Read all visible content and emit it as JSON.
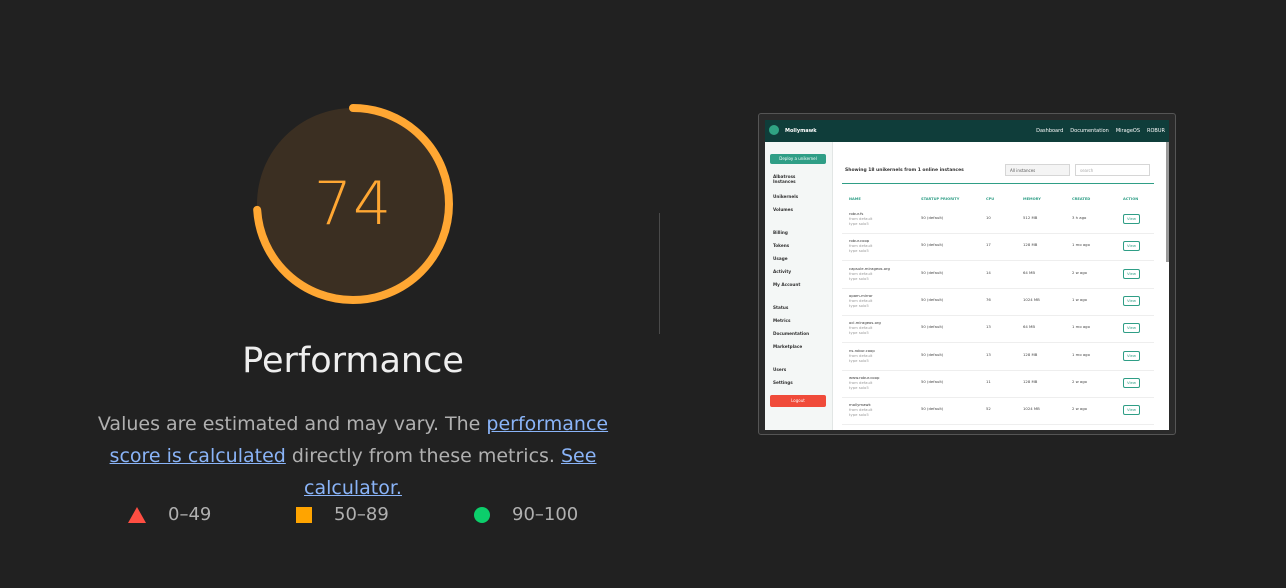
{
  "score": {
    "value": "74",
    "fraction": 0.74,
    "color": "#ffa733",
    "track_fill": "#3b2f22"
  },
  "category": {
    "title": "Performance"
  },
  "description": {
    "prefix": "Values are estimated and may vary. The ",
    "link1": "performance score is calculated",
    "middle": " directly from these metrics. ",
    "link2": "See calculator."
  },
  "legend": [
    {
      "range": "0–49",
      "shape": "triangle",
      "color": "#ff4e42"
    },
    {
      "range": "50–89",
      "shape": "square",
      "color": "#ffa400"
    },
    {
      "range": "90–100",
      "shape": "circle",
      "color": "#0cce6b"
    }
  ],
  "screenshot": {
    "brand": "Mollymawk",
    "nav": [
      "Dashboard",
      "Documentation",
      "MirageOS",
      "ROBUR"
    ],
    "deploy_button": "Deploy a unikernel",
    "sidebar": [
      "Albatross Instances",
      "Unikernels",
      "Volumes",
      "Billing",
      "Tokens",
      "Usage",
      "Activity",
      "My Account",
      "Status",
      "Metrics",
      "Documentation",
      "Marketplace",
      "Users",
      "Settings"
    ],
    "logout": "Logout",
    "heading": "Showing 18 unikernels from 1 online instances",
    "select": "All instances",
    "search_placeholder": "search",
    "columns": [
      "NAME",
      "STARTUP PRIORITY",
      "CPU",
      "MEMORY",
      "CREATED",
      "ACTION"
    ],
    "rows": [
      {
        "name": "robur.fs",
        "sub1": "from default",
        "sub2": "type solo5",
        "prio": "50 (default)",
        "cpu": "10",
        "mem": "512 MB",
        "created": "3 h ago",
        "action": "View"
      },
      {
        "name": "robur.coop",
        "sub1": "from default",
        "sub2": "type solo5",
        "prio": "50 (default)",
        "cpu": "17",
        "mem": "128 MB",
        "created": "1 mo ago",
        "action": "View"
      },
      {
        "name": "capsule.mirageos.org",
        "sub1": "from default",
        "sub2": "type solo5",
        "prio": "50 (default)",
        "cpu": "14",
        "mem": "64 MB",
        "created": "2 w ago",
        "action": "View"
      },
      {
        "name": "opam-mirror",
        "sub1": "from default",
        "sub2": "type solo5",
        "prio": "50 (default)",
        "cpu": "76",
        "mem": "1024 MB",
        "created": "1 w ago",
        "action": "View"
      },
      {
        "name": "ocl.mirageos.org",
        "sub1": "from default",
        "sub2": "type solo5",
        "prio": "50 (default)",
        "cpu": "13",
        "mem": "64 MB",
        "created": "1 mo ago",
        "action": "View"
      },
      {
        "name": "ns.robur.coop",
        "sub1": "from default",
        "sub2": "type solo5",
        "prio": "50 (default)",
        "cpu": "13",
        "mem": "128 MB",
        "created": "1 mo ago",
        "action": "View"
      },
      {
        "name": "www.robur.coop",
        "sub1": "from default",
        "sub2": "type solo5",
        "prio": "50 (default)",
        "cpu": "11",
        "mem": "128 MB",
        "created": "2 w ago",
        "action": "View"
      },
      {
        "name": "mollymawk",
        "sub1": "from default",
        "sub2": "type solo5",
        "prio": "50 (default)",
        "cpu": "52",
        "mem": "1024 MB",
        "created": "2 w ago",
        "action": "View"
      }
    ]
  }
}
